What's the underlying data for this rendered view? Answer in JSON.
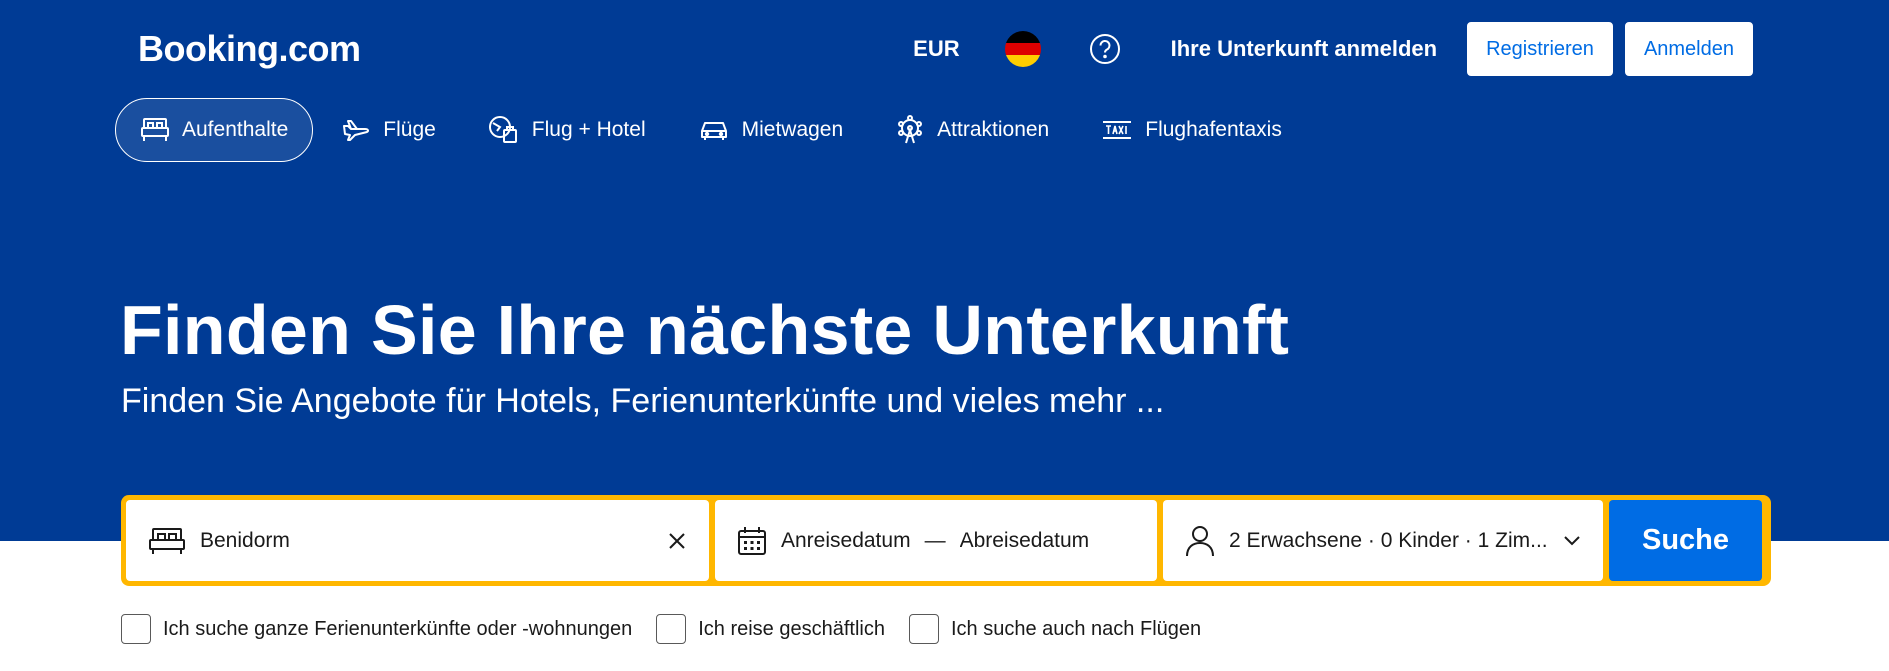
{
  "brand": {
    "logo": "Booking.com"
  },
  "header": {
    "currency": "EUR",
    "language_flag": "flag-germany-icon",
    "help_icon": "question-circle-icon",
    "list_property": "Ihre Unterkunft anmelden",
    "register": "Registrieren",
    "login": "Anmelden"
  },
  "nav": {
    "tabs": [
      {
        "label": "Aufenthalte",
        "icon": "bed-icon",
        "active": true
      },
      {
        "label": "Flüge",
        "icon": "plane-icon",
        "active": false
      },
      {
        "label": "Flug + Hotel",
        "icon": "flight-hotel-icon",
        "active": false
      },
      {
        "label": "Mietwagen",
        "icon": "car-icon",
        "active": false
      },
      {
        "label": "Attraktionen",
        "icon": "ferris-wheel-icon",
        "active": false
      },
      {
        "label": "Flughafentaxis",
        "icon": "taxi-icon",
        "active": false
      }
    ]
  },
  "hero": {
    "title": "Finden Sie Ihre nächste Unterkunft",
    "subtitle": "Finden Sie Angebote für Hotels, Ferienunterkünfte und vieles mehr ..."
  },
  "search": {
    "destination": "Benidorm",
    "checkin": "Anreisedatum",
    "separator": "—",
    "checkout": "Abreisedatum",
    "guests": "2 Erwachsene · 0 Kinder · 1 Zim...",
    "button": "Suche"
  },
  "options": [
    {
      "label": "Ich suche ganze Ferienunterkünfte oder -wohnungen",
      "checked": false
    },
    {
      "label": "Ich reise geschäftlich",
      "checked": false
    },
    {
      "label": "Ich suche auch nach Flügen",
      "checked": false
    }
  ],
  "colors": {
    "brand_blue": "#003b95",
    "action_blue": "#006ce4",
    "search_border": "#ffb700"
  }
}
